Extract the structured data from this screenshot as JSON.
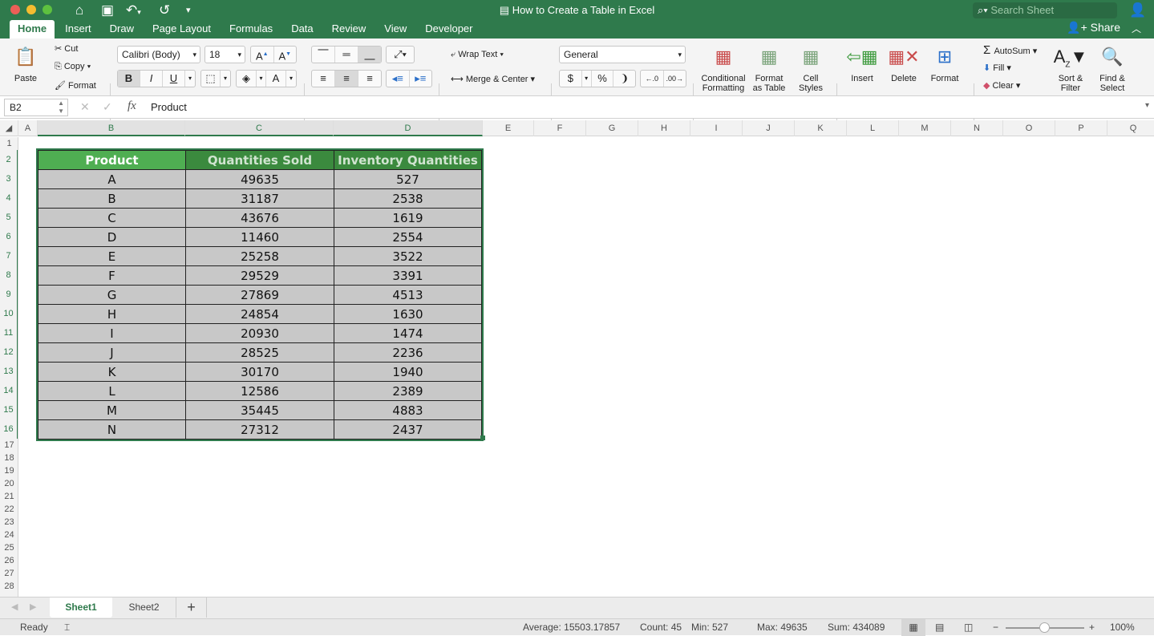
{
  "window": {
    "title": "How to Create a Table in Excel",
    "search_placeholder": "Search Sheet"
  },
  "ribbon_tabs": [
    "Home",
    "Insert",
    "Draw",
    "Page Layout",
    "Formulas",
    "Data",
    "Review",
    "View",
    "Developer"
  ],
  "active_tab": "Home",
  "share_label": "Share",
  "clipboard": {
    "paste": "Paste",
    "cut": "Cut",
    "copy": "Copy",
    "format": "Format"
  },
  "font": {
    "name": "Calibri (Body)",
    "size": "18"
  },
  "alignment": {
    "wrap_text": "Wrap Text",
    "merge_center": "Merge & Center"
  },
  "number": {
    "format": "General",
    "currency": "$",
    "percent": "%",
    "comma": "❩"
  },
  "styles": {
    "conditional": "Conditional Formatting",
    "format_table": "Format as Table",
    "cell_styles": "Cell Styles"
  },
  "cells": {
    "insert": "Insert",
    "delete": "Delete",
    "format": "Format"
  },
  "editing": {
    "autosum": "AutoSum",
    "fill": "Fill",
    "clear": "Clear",
    "sort_filter": "Sort & Filter",
    "find_select": "Find & Select"
  },
  "formula_bar": {
    "name_box": "B2",
    "formula": "Product",
    "fx": "fx"
  },
  "columns": [
    "A",
    "B",
    "C",
    "D",
    "E",
    "F",
    "G",
    "H",
    "I",
    "J",
    "K",
    "L",
    "M",
    "N",
    "O",
    "P",
    "Q"
  ],
  "active_columns": [
    "B",
    "C",
    "D"
  ],
  "rows": [
    "1",
    "2",
    "3",
    "4",
    "5",
    "6",
    "7",
    "8",
    "9",
    "10",
    "11",
    "12",
    "13",
    "14",
    "15",
    "16",
    "17",
    "18",
    "19",
    "20",
    "21",
    "22",
    "23",
    "24",
    "25",
    "26",
    "27",
    "28"
  ],
  "table": {
    "headers": [
      "Product",
      "Quantities Sold",
      "Inventory Quantities"
    ],
    "header_colors": [
      "#4fae52",
      "#3b8a3e",
      "#3b8a3e"
    ],
    "rows": [
      [
        "A",
        "49635",
        "527"
      ],
      [
        "B",
        "31187",
        "2538"
      ],
      [
        "C",
        "43676",
        "1619"
      ],
      [
        "D",
        "11460",
        "2554"
      ],
      [
        "E",
        "25258",
        "3522"
      ],
      [
        "F",
        "29529",
        "3391"
      ],
      [
        "G",
        "27869",
        "4513"
      ],
      [
        "H",
        "24854",
        "1630"
      ],
      [
        "I",
        "20930",
        "1474"
      ],
      [
        "J",
        "28525",
        "2236"
      ],
      [
        "K",
        "30170",
        "1940"
      ],
      [
        "L",
        "12586",
        "2389"
      ],
      [
        "M",
        "35445",
        "4883"
      ],
      [
        "N",
        "27312",
        "2437"
      ]
    ]
  },
  "sheets": [
    "Sheet1",
    "Sheet2"
  ],
  "active_sheet": "Sheet1",
  "status": {
    "mode": "Ready",
    "average": "Average: 15503.17857",
    "count": "Count: 45",
    "min": "Min: 527",
    "max": "Max: 49635",
    "sum": "Sum: 434089",
    "zoom": "100%"
  },
  "colors": {
    "brand": "#2f7a4c",
    "cell_fill": "#c8c8c8"
  }
}
